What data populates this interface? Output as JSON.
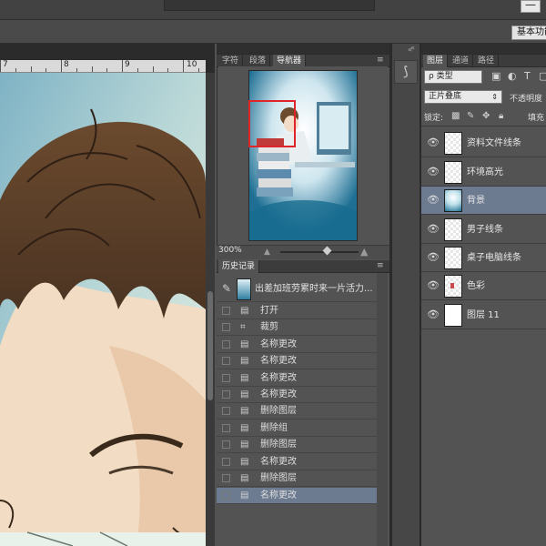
{
  "workspace": {
    "label": "基本功能"
  },
  "window": {
    "minimize_label": "—"
  },
  "ruler": {
    "ticks": [
      "7",
      "8",
      "9",
      "10"
    ]
  },
  "navigator": {
    "tabs": [
      "字符",
      "段落",
      "导航器"
    ],
    "active_tab": "导航器",
    "zoom": "300%"
  },
  "history": {
    "tab": "历史记录",
    "snapshot_label": "出差加班劳累时来一片活力...",
    "items": [
      {
        "label": "打开",
        "icon": "document-icon"
      },
      {
        "label": "裁剪",
        "icon": "crop-icon"
      },
      {
        "label": "名称更改",
        "icon": "document-icon"
      },
      {
        "label": "名称更改",
        "icon": "document-icon"
      },
      {
        "label": "名称更改",
        "icon": "document-icon"
      },
      {
        "label": "名称更改",
        "icon": "document-icon"
      },
      {
        "label": "删除图层",
        "icon": "document-icon"
      },
      {
        "label": "删除组",
        "icon": "document-icon"
      },
      {
        "label": "删除图层",
        "icon": "document-icon"
      },
      {
        "label": "名称更改",
        "icon": "document-icon"
      },
      {
        "label": "删除图层",
        "icon": "document-icon"
      },
      {
        "label": "名称更改",
        "icon": "document-icon",
        "selected": true
      }
    ]
  },
  "layers": {
    "tabs": [
      "图层",
      "通道",
      "路径"
    ],
    "active_tab": "图层",
    "filter": "ρ 类型",
    "blend_mode": "正片叠底",
    "opacity_label": "不透明度",
    "lock_label": "锁定:",
    "fill_label": "填充",
    "items": [
      {
        "name": "资料文件线条"
      },
      {
        "name": "环境高光"
      },
      {
        "name": "背景",
        "selected": true
      },
      {
        "name": "男子线条"
      },
      {
        "name": "桌子电脑线条"
      },
      {
        "name": "色彩"
      },
      {
        "name": "图层 11"
      }
    ]
  },
  "colors": {
    "selection": "#6d7b91",
    "nav_box": "#e0252a",
    "panel": "#535353"
  }
}
